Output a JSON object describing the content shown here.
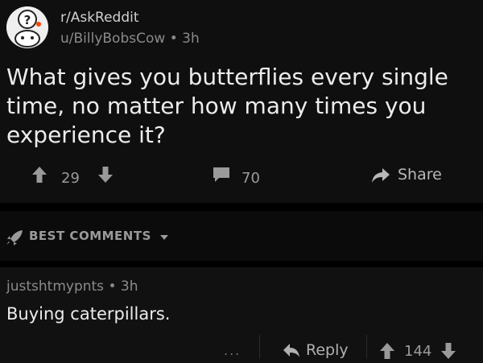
{
  "post": {
    "subreddit": "r/AskReddit",
    "author": "u/BillyBobsCow",
    "separator": "•",
    "age": "3h",
    "title": "What gives you butterflies every single time, no matter how many times you experience it?",
    "upvotes": "29",
    "comments": "70",
    "share_label": "Share"
  },
  "sort": {
    "label": "BEST COMMENTS"
  },
  "comment": {
    "author": "justshtmypnts",
    "separator": "•",
    "age": "3h",
    "body": "Buying caterpillars.",
    "more_label": "...",
    "reply_label": "Reply",
    "score": "144"
  },
  "icons": {
    "subreddit": "askreddit-snoo-icon",
    "upvote": "arrow-up-icon",
    "downvote": "arrow-down-icon",
    "comments": "comment-bubble-icon",
    "share": "share-arrow-icon",
    "sort": "rocket-icon",
    "caret": "caret-down-icon",
    "reply": "reply-arrow-icon"
  }
}
